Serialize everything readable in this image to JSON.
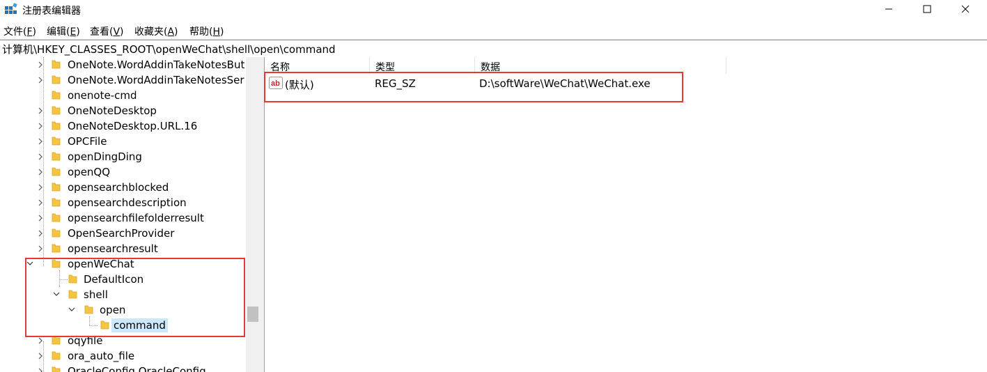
{
  "window": {
    "title": "注册表编辑器",
    "icon": "regedit-icon"
  },
  "menu": [
    {
      "label": "文件(",
      "key": "F",
      "end": ")"
    },
    {
      "label": "编辑(",
      "key": "E",
      "end": ")"
    },
    {
      "label": "查看(",
      "key": "V",
      "end": ")"
    },
    {
      "label": "收藏夹(",
      "key": "A",
      "end": ")"
    },
    {
      "label": "帮助(",
      "key": "H",
      "end": ")"
    }
  ],
  "address": "计算机\\HKEY_CLASSES_ROOT\\openWeChat\\shell\\open\\command",
  "tree": {
    "items": [
      {
        "label": "OneNote.WordAddinTakeNotesBut"
      },
      {
        "label": "OneNote.WordAddinTakeNotesSer"
      },
      {
        "label": "onenote-cmd"
      },
      {
        "label": "OneNoteDesktop"
      },
      {
        "label": "OneNoteDesktop.URL.16"
      },
      {
        "label": "OPCFile"
      },
      {
        "label": "openDingDing"
      },
      {
        "label": "openQQ"
      },
      {
        "label": "opensearchblocked"
      },
      {
        "label": "opensearchdescription"
      },
      {
        "label": "opensearchfilefolderresult"
      },
      {
        "label": "OpenSearchProvider"
      },
      {
        "label": "opensearchresult"
      },
      {
        "label": "openWeChat"
      },
      {
        "label": "DefaultIcon"
      },
      {
        "label": "shell"
      },
      {
        "label": "open"
      },
      {
        "label": "command"
      },
      {
        "label": "oqyfile"
      },
      {
        "label": "ora_auto_file"
      },
      {
        "label": "OracleConfig.OracleConfig"
      }
    ]
  },
  "list": {
    "headers": {
      "name": "名称",
      "type": "类型",
      "data": "数据"
    },
    "rows": [
      {
        "name": "(默认)",
        "type": "REG_SZ",
        "data": "D:\\softWare\\WeChat\\WeChat.exe"
      }
    ]
  },
  "colors": {
    "highlight": "#e53935",
    "selection": "#cce8ff",
    "folder": "#f4c542"
  }
}
